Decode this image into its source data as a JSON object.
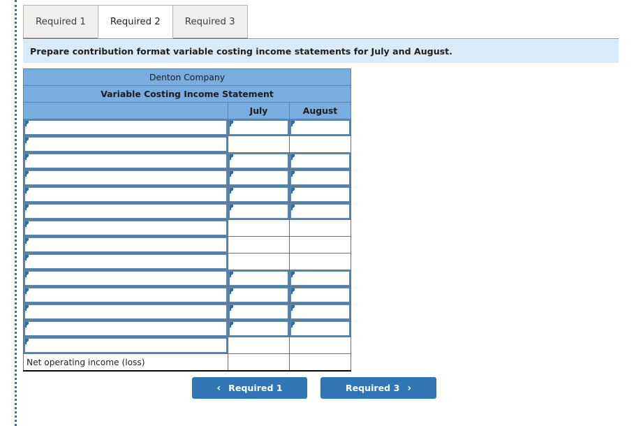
{
  "tabs": [
    {
      "label": "Required 1",
      "active": false
    },
    {
      "label": "Required 2",
      "active": true
    },
    {
      "label": "Required 3",
      "active": false
    }
  ],
  "instruction": "Prepare contribution format variable costing income statements for July and August.",
  "worksheet": {
    "company_title": "Denton Company",
    "statement_title": "Variable Costing Income Statement",
    "columns": [
      {
        "label": ""
      },
      {
        "label": "July"
      },
      {
        "label": "August"
      }
    ],
    "rows": [
      {
        "label": "",
        "label_input": true,
        "july_input": true,
        "august_input": true
      },
      {
        "label": "",
        "label_input": true,
        "july_input": false,
        "august_input": false
      },
      {
        "label": "",
        "label_input": true,
        "july_input": true,
        "august_input": true
      },
      {
        "label": "",
        "label_input": true,
        "july_input": true,
        "august_input": true
      },
      {
        "label": "",
        "label_input": true,
        "july_input": true,
        "august_input": true
      },
      {
        "label": "",
        "label_input": true,
        "july_input": true,
        "august_input": true
      },
      {
        "label": "",
        "label_input": true,
        "july_input": false,
        "august_input": false
      },
      {
        "label": "",
        "label_input": true,
        "july_input": false,
        "august_input": false
      },
      {
        "label": "",
        "label_input": true,
        "july_input": false,
        "august_input": false
      },
      {
        "label": "",
        "label_input": true,
        "july_input": true,
        "august_input": true
      },
      {
        "label": "",
        "label_input": true,
        "july_input": true,
        "august_input": true
      },
      {
        "label": "",
        "label_input": true,
        "july_input": true,
        "august_input": true
      },
      {
        "label": "",
        "label_input": true,
        "july_input": true,
        "august_input": true
      },
      {
        "label": "",
        "label_input": true,
        "july_input": false,
        "august_input": false
      },
      {
        "label": "Net operating income (loss)",
        "label_input": false,
        "july_input": false,
        "august_input": false
      }
    ]
  },
  "navigation": {
    "prev_label": "Required 1",
    "prev_icon": "chevron-left-icon",
    "prev_glyph": "‹",
    "next_label": "Required 3",
    "next_icon": "chevron-right-icon",
    "next_glyph": "›"
  },
  "colors": {
    "header_blue": "#79ACDF",
    "banner_blue": "#d9ebf9",
    "button_blue": "#3175b5",
    "input_border": "#5289bd",
    "marker_blue": "#2e6ca4"
  }
}
